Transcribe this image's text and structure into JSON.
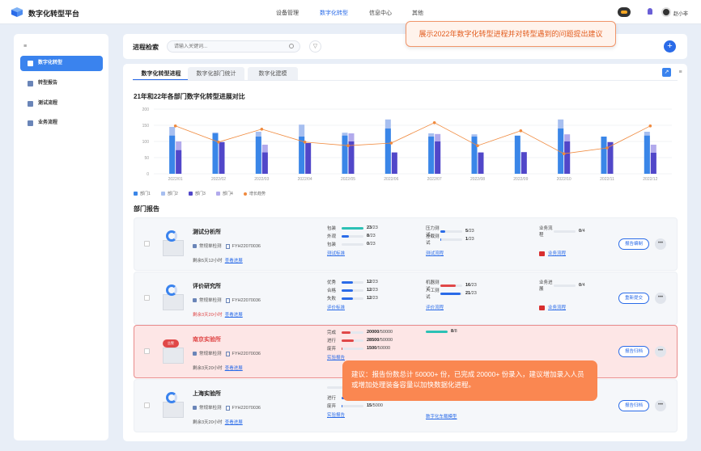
{
  "app": {
    "title": "数字化转型平台",
    "logo_icon": "cube-logo-icon",
    "username": "赵小非"
  },
  "nav": [
    "设备管理",
    "数字化转型",
    "信息中心",
    "其他"
  ],
  "sidebar": {
    "items": [
      {
        "label": "数字化转型",
        "icon": "users-icon",
        "active": true
      },
      {
        "label": "转型报告",
        "icon": "report-icon",
        "active": false
      },
      {
        "label": "测试流程",
        "icon": "flow-icon",
        "active": false
      },
      {
        "label": "业务流程",
        "icon": "business-icon",
        "active": false
      }
    ]
  },
  "search": {
    "label": "进程检索",
    "placeholder": "请输入关键词..."
  },
  "tabs": [
    "数字化转型进程",
    "数字化部门统计",
    "数字化建模"
  ],
  "chart_data": {
    "type": "bar",
    "title": "21年和22年各部门数字化转型进展对比",
    "categories": [
      "2022/01",
      "2022/02",
      "2022/03",
      "2022/04",
      "2022/05",
      "2022/06",
      "2022/07",
      "2022/08",
      "2022/09",
      "2022/10",
      "2022/11",
      "2022/12"
    ],
    "ylim": [
      0,
      200
    ],
    "yticks": [
      0,
      50,
      100,
      150,
      200
    ],
    "series": [
      {
        "name": "部门1",
        "type": "bar",
        "color": "#3a86e8",
        "values": [
          118,
          125,
          115,
          115,
          118,
          140,
          115,
          115,
          118,
          140,
          115,
          118
        ]
      },
      {
        "name": "部门2",
        "type": "bar",
        "color": "#a7bff0",
        "values": [
          145,
          128,
          130,
          152,
          127,
          168,
          125,
          122,
          0,
          168,
          0,
          130
        ]
      },
      {
        "name": "部门3",
        "type": "bar",
        "color": "#5147c9",
        "values": [
          73,
          98,
          66,
          95,
          100,
          66,
          100,
          66,
          67,
          100,
          98,
          65
        ]
      },
      {
        "name": "部门4",
        "type": "bar",
        "color": "#b2aaec",
        "values": [
          100,
          0,
          90,
          0,
          125,
          0,
          123,
          0,
          0,
          122,
          0,
          90
        ]
      },
      {
        "name": "增长趋势",
        "type": "line",
        "color": "#f08a3e",
        "values": [
          148,
          98,
          138,
          98,
          87,
          95,
          158,
          87,
          133,
          62,
          80,
          148
        ]
      }
    ]
  },
  "section_title": "部门报告",
  "cards": [
    {
      "org": "测试分析所",
      "type": "常规单检测",
      "doc": "FYH22070036",
      "remain": "剩余5天12小时",
      "remain_red": false,
      "link": "查看进展",
      "m1": [
        {
          "n": "包装",
          "p": 1.0,
          "c": "#2cc1b5",
          "v": "23",
          "t": "/23"
        },
        {
          "n": "外观",
          "p": 0.35,
          "c": "#2a6be8",
          "v": "8",
          "t": "/23"
        },
        {
          "n": "包装",
          "p": 0,
          "c": "#2a6be8",
          "v": "0",
          "t": "/23"
        }
      ],
      "m1link": "测试标准",
      "m2": [
        {
          "n": "压力测试",
          "p": 0.22,
          "c": "#2a6be8",
          "v": "5",
          "t": "/23"
        },
        {
          "n": "挂载测试",
          "p": 0.05,
          "c": "#2a6be8",
          "v": "1",
          "t": "/23"
        }
      ],
      "m2link": "测试流程",
      "m3": [
        {
          "n": "业务流程",
          "p": 0,
          "c": "#2a6be8",
          "v": "0",
          "t": "/4"
        }
      ],
      "m3link": "业务流程",
      "action": "报告编制"
    },
    {
      "org": "评价研究所",
      "type": "常规单检测",
      "doc": "FYH22070036",
      "remain": "剩余3天20小时",
      "remain_red": true,
      "link": "查看进展",
      "m1": [
        {
          "n": "优秀",
          "p": 0.52,
          "c": "#2a6be8",
          "v": "12",
          "t": "/23"
        },
        {
          "n": "合格",
          "p": 0.52,
          "c": "#2a6be8",
          "v": "12",
          "t": "/23"
        },
        {
          "n": "失败",
          "p": 0.52,
          "c": "#2a6be8",
          "v": "12",
          "t": "/23"
        }
      ],
      "m1link": "评价标准",
      "m2": [
        {
          "n": "机器测试",
          "p": 0.7,
          "c": "#e04848",
          "v": "16",
          "t": "/23"
        },
        {
          "n": "人工测试",
          "p": 0.91,
          "c": "#2a6be8",
          "v": "21",
          "t": "/23"
        }
      ],
      "m2link": "评价流程",
      "m3": [
        {
          "n": "业务进展",
          "p": 0,
          "c": "#2a6be8",
          "v": "0",
          "t": "/4"
        }
      ],
      "m3link": "业务流程",
      "action": "重新提交"
    },
    {
      "org": "南京实验所",
      "badge": "告警",
      "type": "常规单检测",
      "doc": "FYH22070036",
      "remain": "剩余3天20小时",
      "remain_red": false,
      "link": "查看进展",
      "m1": [
        {
          "n": "完成",
          "p": 0.4,
          "c": "#e04848",
          "v": "20000",
          "t": "/50000"
        },
        {
          "n": "进行",
          "p": 0.57,
          "c": "#e04848",
          "v": "28500",
          "t": "/50000"
        },
        {
          "n": "废弃",
          "p": 0.03,
          "c": "#e04848",
          "v": "1500",
          "t": "/50000"
        }
      ],
      "m1link": "实验报告",
      "m2": [
        {
          "n": "",
          "p": 1.0,
          "c": "#2cc1b5",
          "v": "8",
          "t": "/8"
        }
      ],
      "m2link": "",
      "m3": [],
      "m3link": "",
      "action": "报告归档"
    },
    {
      "org": "上海实验所",
      "type": "常规单检测",
      "doc": "FYH22070036",
      "remain": "剩余3天20小时",
      "remain_red": false,
      "link": "查看进展",
      "m1": [
        {
          "n": "",
          "p": 0,
          "c": "#2a6be8",
          "v": "",
          "t": ""
        },
        {
          "n": "进行",
          "p": 0.2,
          "c": "#2a6be8",
          "v": "",
          "t": ""
        },
        {
          "n": "废弃",
          "p": 0.05,
          "c": "#2a6be8",
          "v": "15",
          "t": "/5000"
        }
      ],
      "m1link": "实验报告",
      "m2": [],
      "m2link": "数字化车载模型",
      "m3": [],
      "m3link": "",
      "action": "报告归档"
    }
  ],
  "callouts": {
    "top": "展示2022年数字化转型进程并对转型遇到的问题提出建议",
    "bottom": "建议：报告份数总计 50000+ 份，已完成 20000+ 份录入，建议增加录入人员或增加处理装备容量以加快数据化进程。"
  }
}
